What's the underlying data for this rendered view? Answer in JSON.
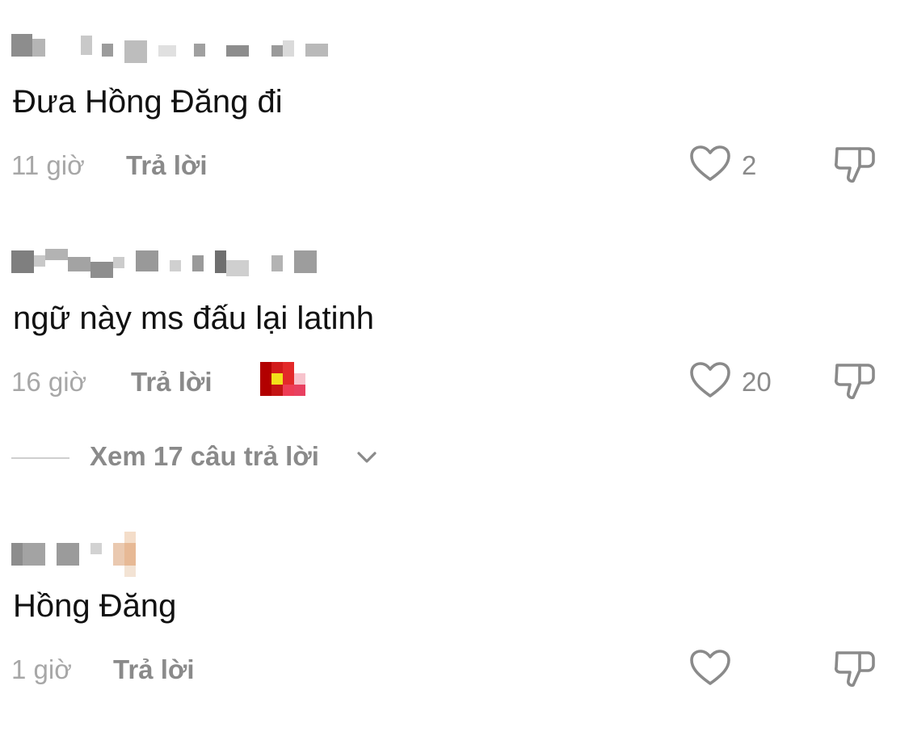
{
  "comments": [
    {
      "text": "Đưa Hồng Đăng đi",
      "time": "11 giờ",
      "reply_label": "Trả lời",
      "likes": "2"
    },
    {
      "text": "ngữ này ms đấu lại latinh",
      "time": "16 giờ",
      "reply_label": "Trả lời",
      "likes": "20"
    },
    {
      "text": "Hồng Đăng",
      "time": "1 giờ",
      "reply_label": "Trả lời",
      "likes": ""
    }
  ],
  "view_replies": {
    "label": "Xem 17 câu trả lời"
  },
  "icons": {
    "like": "heart-outline-icon",
    "dislike": "thumbs-down-outline-icon",
    "expand": "chevron-down-icon"
  },
  "colors": {
    "text": "#111111",
    "meta": "#a7a7a7",
    "reply": "#8a8a8a",
    "icon": "#8a8a8a"
  }
}
